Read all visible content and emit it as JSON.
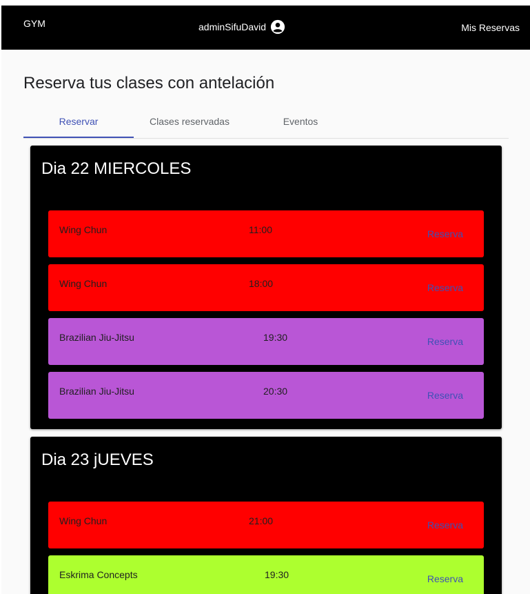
{
  "header": {
    "brand": "GYM",
    "username": "adminSifuDavid",
    "user_icon": "account-circle-icon",
    "my_bookings_label": "Mis Reservas"
  },
  "page": {
    "title": "Reserva tus clases con antelación"
  },
  "tabs": [
    {
      "label": "Reservar",
      "active": true
    },
    {
      "label": "Clases reservadas",
      "active": false
    },
    {
      "label": "Eventos",
      "active": false
    }
  ],
  "days": [
    {
      "title": "Dia 22 MIERCOLES",
      "classes": [
        {
          "name": "Wing Chun",
          "time": "11:00",
          "button": "Reserva",
          "color": "#ff0000"
        },
        {
          "name": "Wing Chun",
          "time": "18:00",
          "button": "Reserva",
          "color": "#ff0000"
        },
        {
          "name": "Brazilian Jiu-Jitsu",
          "time": "19:30",
          "button": "Reserva",
          "color": "#b956d6"
        },
        {
          "name": "Brazilian Jiu-Jitsu",
          "time": "20:30",
          "button": "Reserva",
          "color": "#b956d6"
        }
      ]
    },
    {
      "title": "Dia 23 jUEVES",
      "classes": [
        {
          "name": "Wing Chun",
          "time": "21:00",
          "button": "Reserva",
          "color": "#ff0000"
        },
        {
          "name": "Eskrima Concepts",
          "time": "19:30",
          "button": "Reserva",
          "color": "#adff2f"
        }
      ]
    }
  ],
  "colors": {
    "accent": "#3f51b5",
    "topbar": "#000000"
  }
}
